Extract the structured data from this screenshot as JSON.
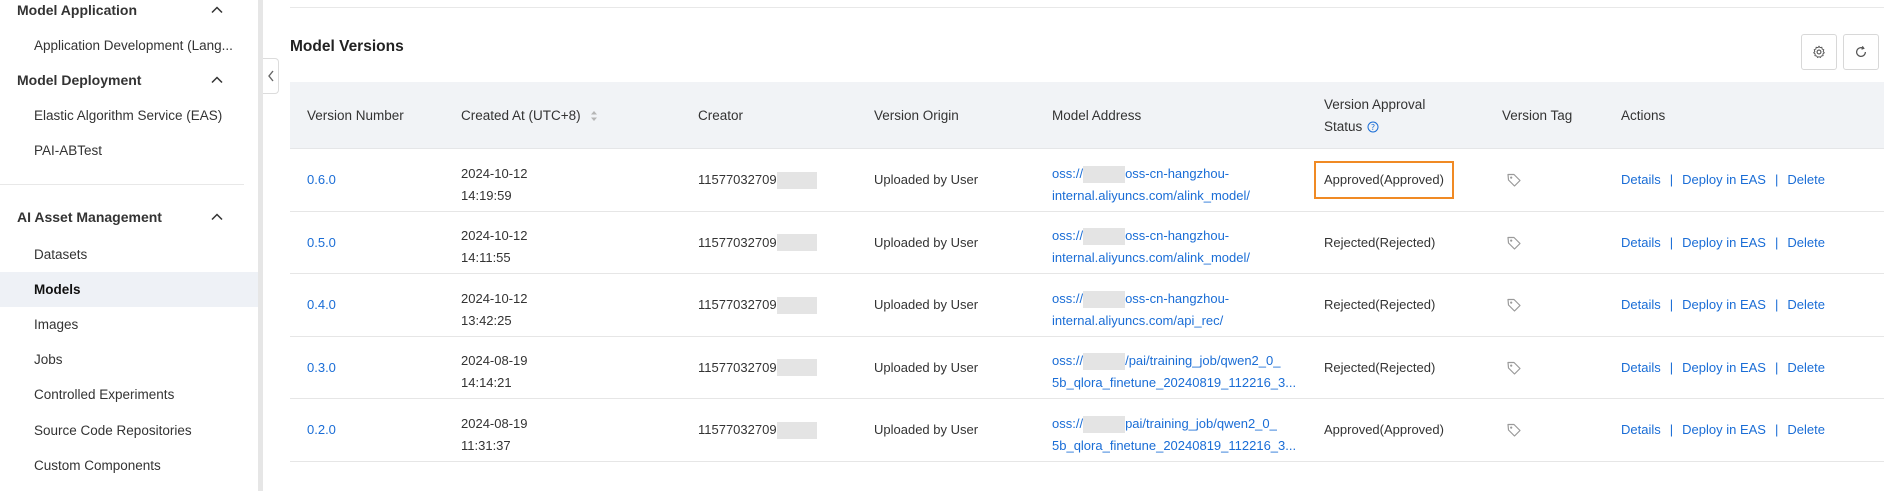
{
  "sidebar": {
    "sections": [
      {
        "title": "Model Application",
        "items": [
          {
            "label": "Application Development (Lang..."
          }
        ]
      },
      {
        "title": "Model Deployment",
        "items": [
          {
            "label": "Elastic Algorithm Service (EAS)"
          },
          {
            "label": "PAI-ABTest"
          }
        ]
      },
      {
        "title": "AI Asset Management",
        "items": [
          {
            "label": "Datasets"
          },
          {
            "label": "Models"
          },
          {
            "label": "Images"
          },
          {
            "label": "Jobs"
          },
          {
            "label": "Controlled Experiments"
          },
          {
            "label": "Source Code Repositories"
          },
          {
            "label": "Custom Components"
          }
        ]
      }
    ],
    "active_item": "Models"
  },
  "main": {
    "title": "Model Versions",
    "columns": {
      "version_number": "Version Number",
      "created_at": "Created At (UTC+8)",
      "creator": "Creator",
      "version_origin": "Version Origin",
      "model_address": "Model Address",
      "approval_line1": "Version Approval",
      "approval_line2": "Status",
      "version_tag": "Version Tag",
      "actions": "Actions"
    },
    "rows": [
      {
        "version": "0.6.0",
        "date": "2024-10-12",
        "time": "14:19:59",
        "creator": "11577032709",
        "origin": "Uploaded by User",
        "addr_prefix": "oss://",
        "addr_line1": "oss-cn-hangzhou-",
        "addr_line2": "internal.aliyuncs.com/alink_model/",
        "status": "Approved(Approved)"
      },
      {
        "version": "0.5.0",
        "date": "2024-10-12",
        "time": "14:11:55",
        "creator": "11577032709",
        "origin": "Uploaded by User",
        "addr_prefix": "oss://",
        "addr_line1": "oss-cn-hangzhou-",
        "addr_line2": "internal.aliyuncs.com/alink_model/",
        "status": "Rejected(Rejected)"
      },
      {
        "version": "0.4.0",
        "date": "2024-10-12",
        "time": "13:42:25",
        "creator": "11577032709",
        "origin": "Uploaded by User",
        "addr_prefix": "oss://",
        "addr_line1": "oss-cn-hangzhou-",
        "addr_line2": "internal.aliyuncs.com/api_rec/",
        "status": "Rejected(Rejected)"
      },
      {
        "version": "0.3.0",
        "date": "2024-08-19",
        "time": "14:14:21",
        "creator": "11577032709",
        "origin": "Uploaded by User",
        "addr_prefix": "oss://",
        "addr_line1": "/pai/training_job/qwen2_0_",
        "addr_line2": "5b_qlora_finetune_20240819_112216_3...",
        "status": "Rejected(Rejected)"
      },
      {
        "version": "0.2.0",
        "date": "2024-08-19",
        "time": "11:31:37",
        "creator": "11577032709",
        "origin": "Uploaded by User",
        "addr_prefix": "oss://",
        "addr_line1": "pai/training_job/qwen2_0_",
        "addr_line2": "5b_qlora_finetune_20240819_112216_3...",
        "status": "Approved(Approved)"
      }
    ],
    "actions": {
      "details": "Details",
      "deploy": "Deploy in EAS",
      "delete": "Delete"
    }
  }
}
